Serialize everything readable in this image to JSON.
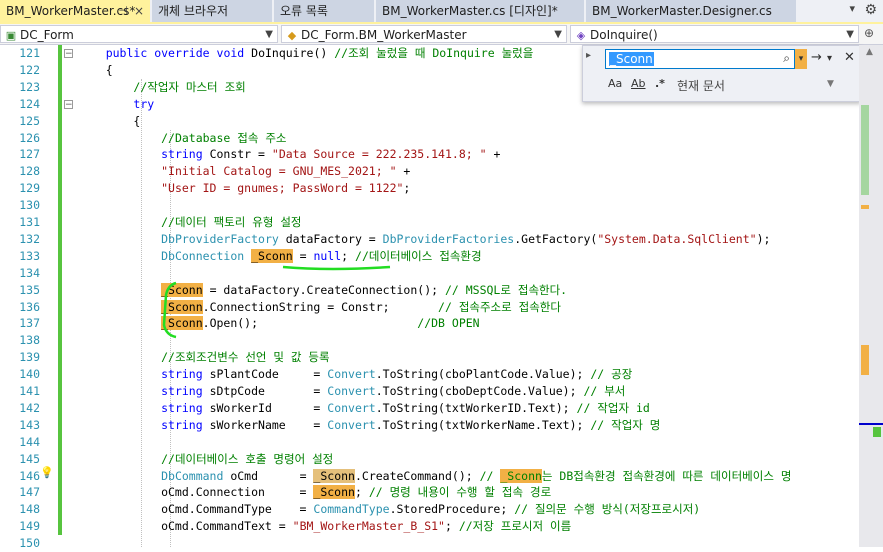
{
  "tabs": [
    {
      "label": "BM_WorkerMaster.cs*",
      "pin": "⊣",
      "close": "×"
    },
    {
      "label": "개체 브라우저"
    },
    {
      "label": "오류 목록"
    },
    {
      "label": "BM_WorkerMaster.cs [디자인]*"
    },
    {
      "label": "BM_WorkerMaster.Designer.cs"
    }
  ],
  "navbar": {
    "project": "DC_Form",
    "class": "DC_Form.BM_WorkerMaster",
    "member": "DoInquire()"
  },
  "find": {
    "query": "_Sconn",
    "scope": "현재 문서",
    "match_case": "Aa",
    "whole_word": "Ab",
    "regex": ".*"
  },
  "lines": [
    {
      "num": "121",
      "html": "    <span class='kw'>public</span> <span class='kw'>override</span> <span class='kw'>void</span> DoInquire() <span class='cm'>//조회 눌렀을 때 DoInquire 눌렀을</span>"
    },
    {
      "num": "122",
      "html": "    {"
    },
    {
      "num": "123",
      "html": "        <span class='cm'>//작업자 마스터 조회</span>"
    },
    {
      "num": "124",
      "html": "        <span class='kw'>try</span>"
    },
    {
      "num": "125",
      "html": "        {"
    },
    {
      "num": "126",
      "html": "            <span class='cm'>//Database 접속 주소</span>"
    },
    {
      "num": "127",
      "html": "            <span class='kw'>string</span> Constr = <span class='st'>\"Data Source = 222.235.141.8; \"</span> +"
    },
    {
      "num": "128",
      "html": "            <span class='st'>\"Initial Catalog = GNU_MES_2021; \"</span> +"
    },
    {
      "num": "129",
      "html": "            <span class='st'>\"User ID = gnumes; PassWord = 1122\"</span>;"
    },
    {
      "num": "130",
      "html": ""
    },
    {
      "num": "131",
      "html": "            <span class='cm'>//데이터 팩토리 유형 설정</span>"
    },
    {
      "num": "132",
      "html": "            <span class='ty'>DbProviderFactory</span> dataFactory = <span class='ty'>DbProviderFactories</span>.GetFactory(<span class='st'>\"System.Data.SqlClient\"</span>);"
    },
    {
      "num": "133",
      "html": "            <span class='ty'>DbConnection</span> <span class='hl'>_Sconn</span> = <span class='kw'>null</span>; <span class='cm'>//데이터베이스 접속환경</span>"
    },
    {
      "num": "134",
      "html": ""
    },
    {
      "num": "135",
      "html": "            <span class='hl'>_Sconn</span> = dataFactory.CreateConnection(); <span class='cm'>// MSSQL로 접속한다.</span>"
    },
    {
      "num": "136",
      "html": "            <span class='hl'>_Sconn</span>.ConnectionString = Constr;       <span class='cm'>// 접속주소로 접속한다</span>"
    },
    {
      "num": "137",
      "html": "            <span class='hl'>_Sconn</span>.Open();                       <span class='cm'>//DB OPEN</span>"
    },
    {
      "num": "138",
      "html": ""
    },
    {
      "num": "139",
      "html": "            <span class='cm'>//조회조건변수 선언 및 값 등록</span>"
    },
    {
      "num": "140",
      "html": "            <span class='kw'>string</span> sPlantCode     = <span class='ty'>Convert</span>.ToString(cboPlantCode.Value); <span class='cm'>// 공장</span>"
    },
    {
      "num": "141",
      "html": "            <span class='kw'>string</span> sDtpCode       = <span class='ty'>Convert</span>.ToString(cboDeptCode.Value); <span class='cm'>// 부서</span>"
    },
    {
      "num": "142",
      "html": "            <span class='kw'>string</span> sWorkerId      = <span class='ty'>Convert</span>.ToString(txtWorkerID.Text); <span class='cm'>// 작업자 id</span>"
    },
    {
      "num": "143",
      "html": "            <span class='kw'>string</span> sWorkerName    = <span class='ty'>Convert</span>.ToString(txtWorkerName.Text); <span class='cm'>// 작업자 명</span>"
    },
    {
      "num": "144",
      "html": ""
    },
    {
      "num": "145",
      "html": "            <span class='cm'>//데이터베이스 호출 명령어 설정</span>"
    },
    {
      "num": "146",
      "html": "            <span class='ty'>DbCommand</span> oCmd      = <span class='hl2'>_Sconn</span>.CreateCommand(); <span class='cm'>// <span class='hl'>_Sconn</span>는 DB접속환경 접속환경에 따른 데이터베이스 명</span>"
    },
    {
      "num": "147",
      "html": "            oCmd.Connection     = <span class='hl'>_Sconn</span>; <span class='cm'>// 명령 내용이 수행 할 접속 경로</span>"
    },
    {
      "num": "148",
      "html": "            oCmd.CommandType    = <span class='ty'>CommandType</span>.StoredProcedure; <span class='cm'>// 질의문 수행 방식(저장프로시저)</span>"
    },
    {
      "num": "149",
      "html": "            oCmd.CommandText = <span class='st'>\"BM_WorkerMaster_B_S1\"</span>; <span class='cm'>//저장 프로시저 이름</span>"
    },
    {
      "num": "150",
      "html": ""
    }
  ]
}
